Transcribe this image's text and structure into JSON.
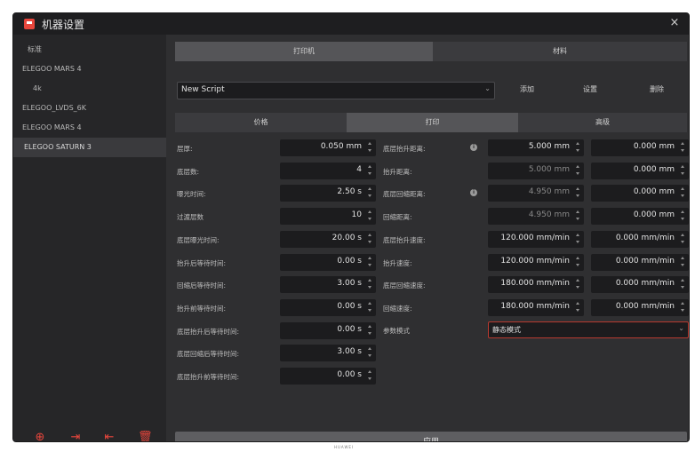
{
  "window": {
    "title": "机器设置",
    "close": "×",
    "accent": "#e8463c"
  },
  "sidebar": {
    "items": [
      {
        "label": "标准"
      },
      {
        "label": "ELEGOO MARS 4"
      },
      {
        "label": "4k"
      },
      {
        "label": "ELEGOO_LVDS_6K"
      },
      {
        "label": "ELEGOO MARS 4"
      },
      {
        "label": "ELEGOO SATURN 3"
      }
    ],
    "selected_index": 5,
    "bottom_icons": [
      {
        "name": "add-icon",
        "glyph": "⊕"
      },
      {
        "name": "import-icon",
        "glyph": "⇥"
      },
      {
        "name": "export-icon",
        "glyph": "⇤"
      },
      {
        "name": "delete-icon",
        "glyph": "🗑"
      }
    ]
  },
  "top_tabs": [
    "打印机",
    "材料"
  ],
  "script": {
    "value": "New Script",
    "add": "添加",
    "settings": "设置",
    "delete": "删除"
  },
  "sub_tabs": [
    "价格",
    "打印",
    "高级"
  ],
  "left_fields": [
    {
      "label": "层厚:",
      "value": "0.050 mm"
    },
    {
      "label": "底层数:",
      "value": "4"
    },
    {
      "label": "曝光时间:",
      "value": "2.50 s"
    },
    {
      "label": "过渡层数",
      "value": "10"
    },
    {
      "label": "底层曝光时间:",
      "value": "20.00 s"
    },
    {
      "label": "抬升后等待时间:",
      "value": "0.00 s"
    },
    {
      "label": "回缩后等待时间:",
      "value": "3.00 s"
    },
    {
      "label": "抬升前等待时间:",
      "value": "0.00 s"
    },
    {
      "label": "底层抬升后等待时间:",
      "value": "0.00 s"
    },
    {
      "label": "底层回缩后等待时间:",
      "value": "3.00 s"
    },
    {
      "label": "底层抬升前等待时间:",
      "value": "0.00 s"
    }
  ],
  "right_fields": [
    {
      "label": "底层抬升距离:",
      "info": true,
      "value1": "5.000 mm",
      "value2": "0.000 mm",
      "disabled1": false
    },
    {
      "label": "抬升距离:",
      "info": false,
      "value1": "5.000 mm",
      "value2": "0.000 mm",
      "disabled1": true
    },
    {
      "label": "底层回缩距离:",
      "info": true,
      "value1": "4.950 mm",
      "value2": "0.000 mm",
      "disabled1": true
    },
    {
      "label": "回缩距离:",
      "info": false,
      "value1": "4.950 mm",
      "value2": "0.000 mm",
      "disabled1": true
    },
    {
      "label": "底层抬升速度:",
      "info": false,
      "value1": "120.000 mm/min",
      "value2": "0.000 mm/min",
      "disabled1": false
    },
    {
      "label": "抬升速度:",
      "info": false,
      "value1": "120.000 mm/min",
      "value2": "0.000 mm/min",
      "disabled1": false
    },
    {
      "label": "底层回缩速度:",
      "info": false,
      "value1": "180.000 mm/min",
      "value2": "0.000 mm/min",
      "disabled1": false
    },
    {
      "label": "回缩速度:",
      "info": false,
      "value1": "180.000 mm/min",
      "value2": "0.000 mm/min",
      "disabled1": false
    }
  ],
  "mode": {
    "label": "参数模式",
    "value": "静态模式"
  },
  "apply_label": "应用",
  "footer": "HUAWEI"
}
